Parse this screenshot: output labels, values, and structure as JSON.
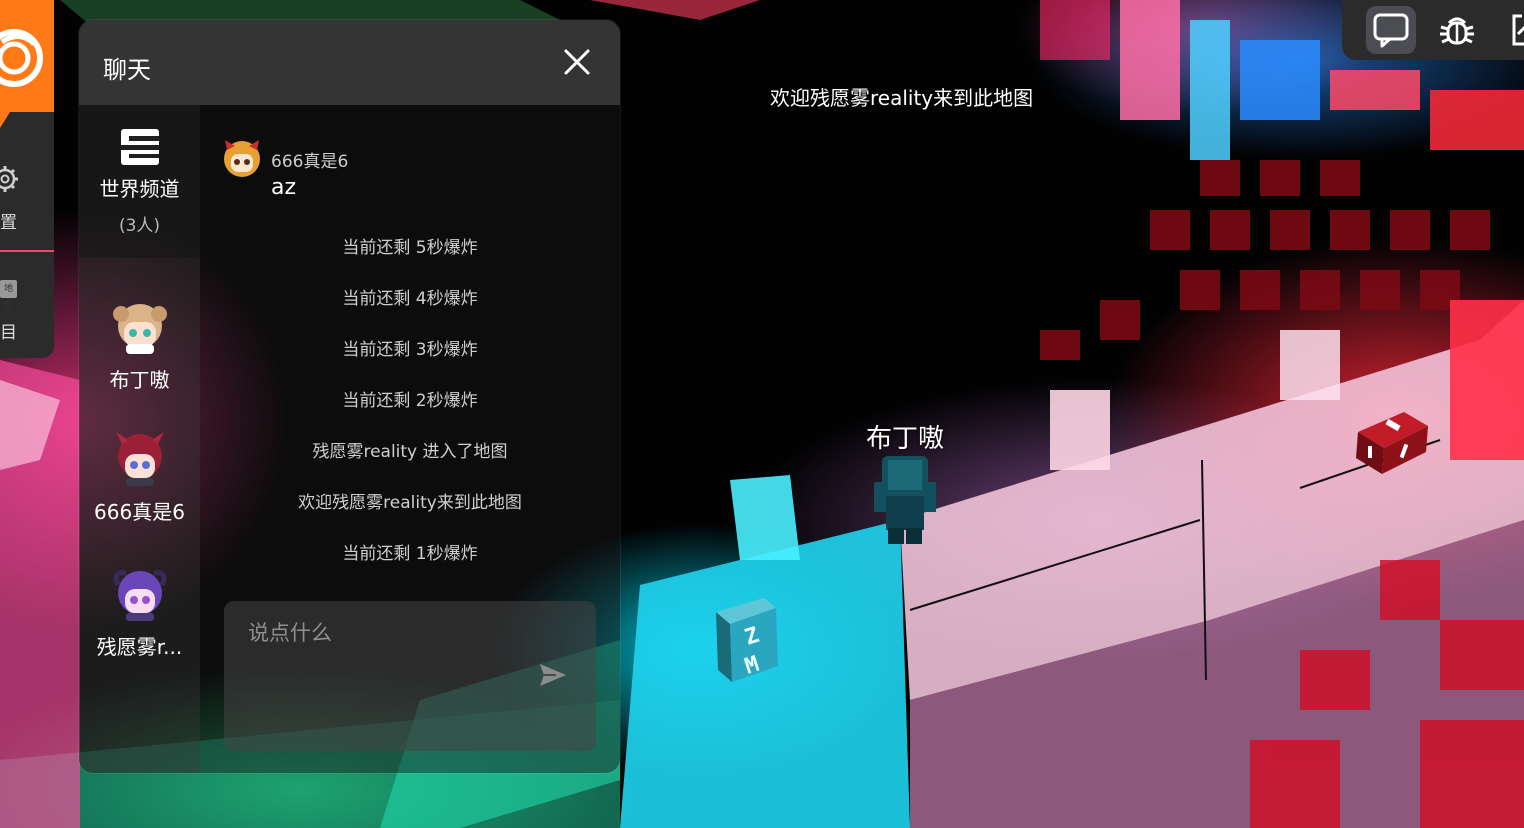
{
  "scene": {
    "welcome_banner": "欢迎残愿雾reality来到此地图",
    "player_name": "布丁嗷",
    "sign_text": "ZM",
    "dice_label": "dice"
  },
  "left_menu": {
    "settings_label": "置",
    "item_label": "目",
    "badge": "地图"
  },
  "toolbar": {
    "buttons": [
      {
        "icon": "chat-bubble-icon",
        "active": true
      },
      {
        "icon": "bug-icon",
        "active": false
      },
      {
        "icon": "fullscreen-icon",
        "active": false
      }
    ]
  },
  "chat": {
    "title": "聊天",
    "channels": [
      {
        "name": "世界频道",
        "count": "(3人)"
      }
    ],
    "users": [
      {
        "name": "布丁嗷"
      },
      {
        "name": "666真是6"
      },
      {
        "name": "残愿雾r..."
      }
    ],
    "messages": [
      {
        "author": "666真是6",
        "text": "az"
      }
    ],
    "system_messages": [
      "当前还剩 5秒爆炸",
      "当前还剩 4秒爆炸",
      "当前还剩 3秒爆炸",
      "当前还剩 2秒爆炸",
      "残愿雾reality 进入了地图",
      "欢迎残愿雾reality来到此地图",
      "当前还剩 1秒爆炸"
    ],
    "input_placeholder": "说点什么"
  },
  "colors": {
    "brand_orange": "#ff7a17",
    "panel_header": "#343434",
    "toolbar_bg": "#2b2b2b"
  }
}
